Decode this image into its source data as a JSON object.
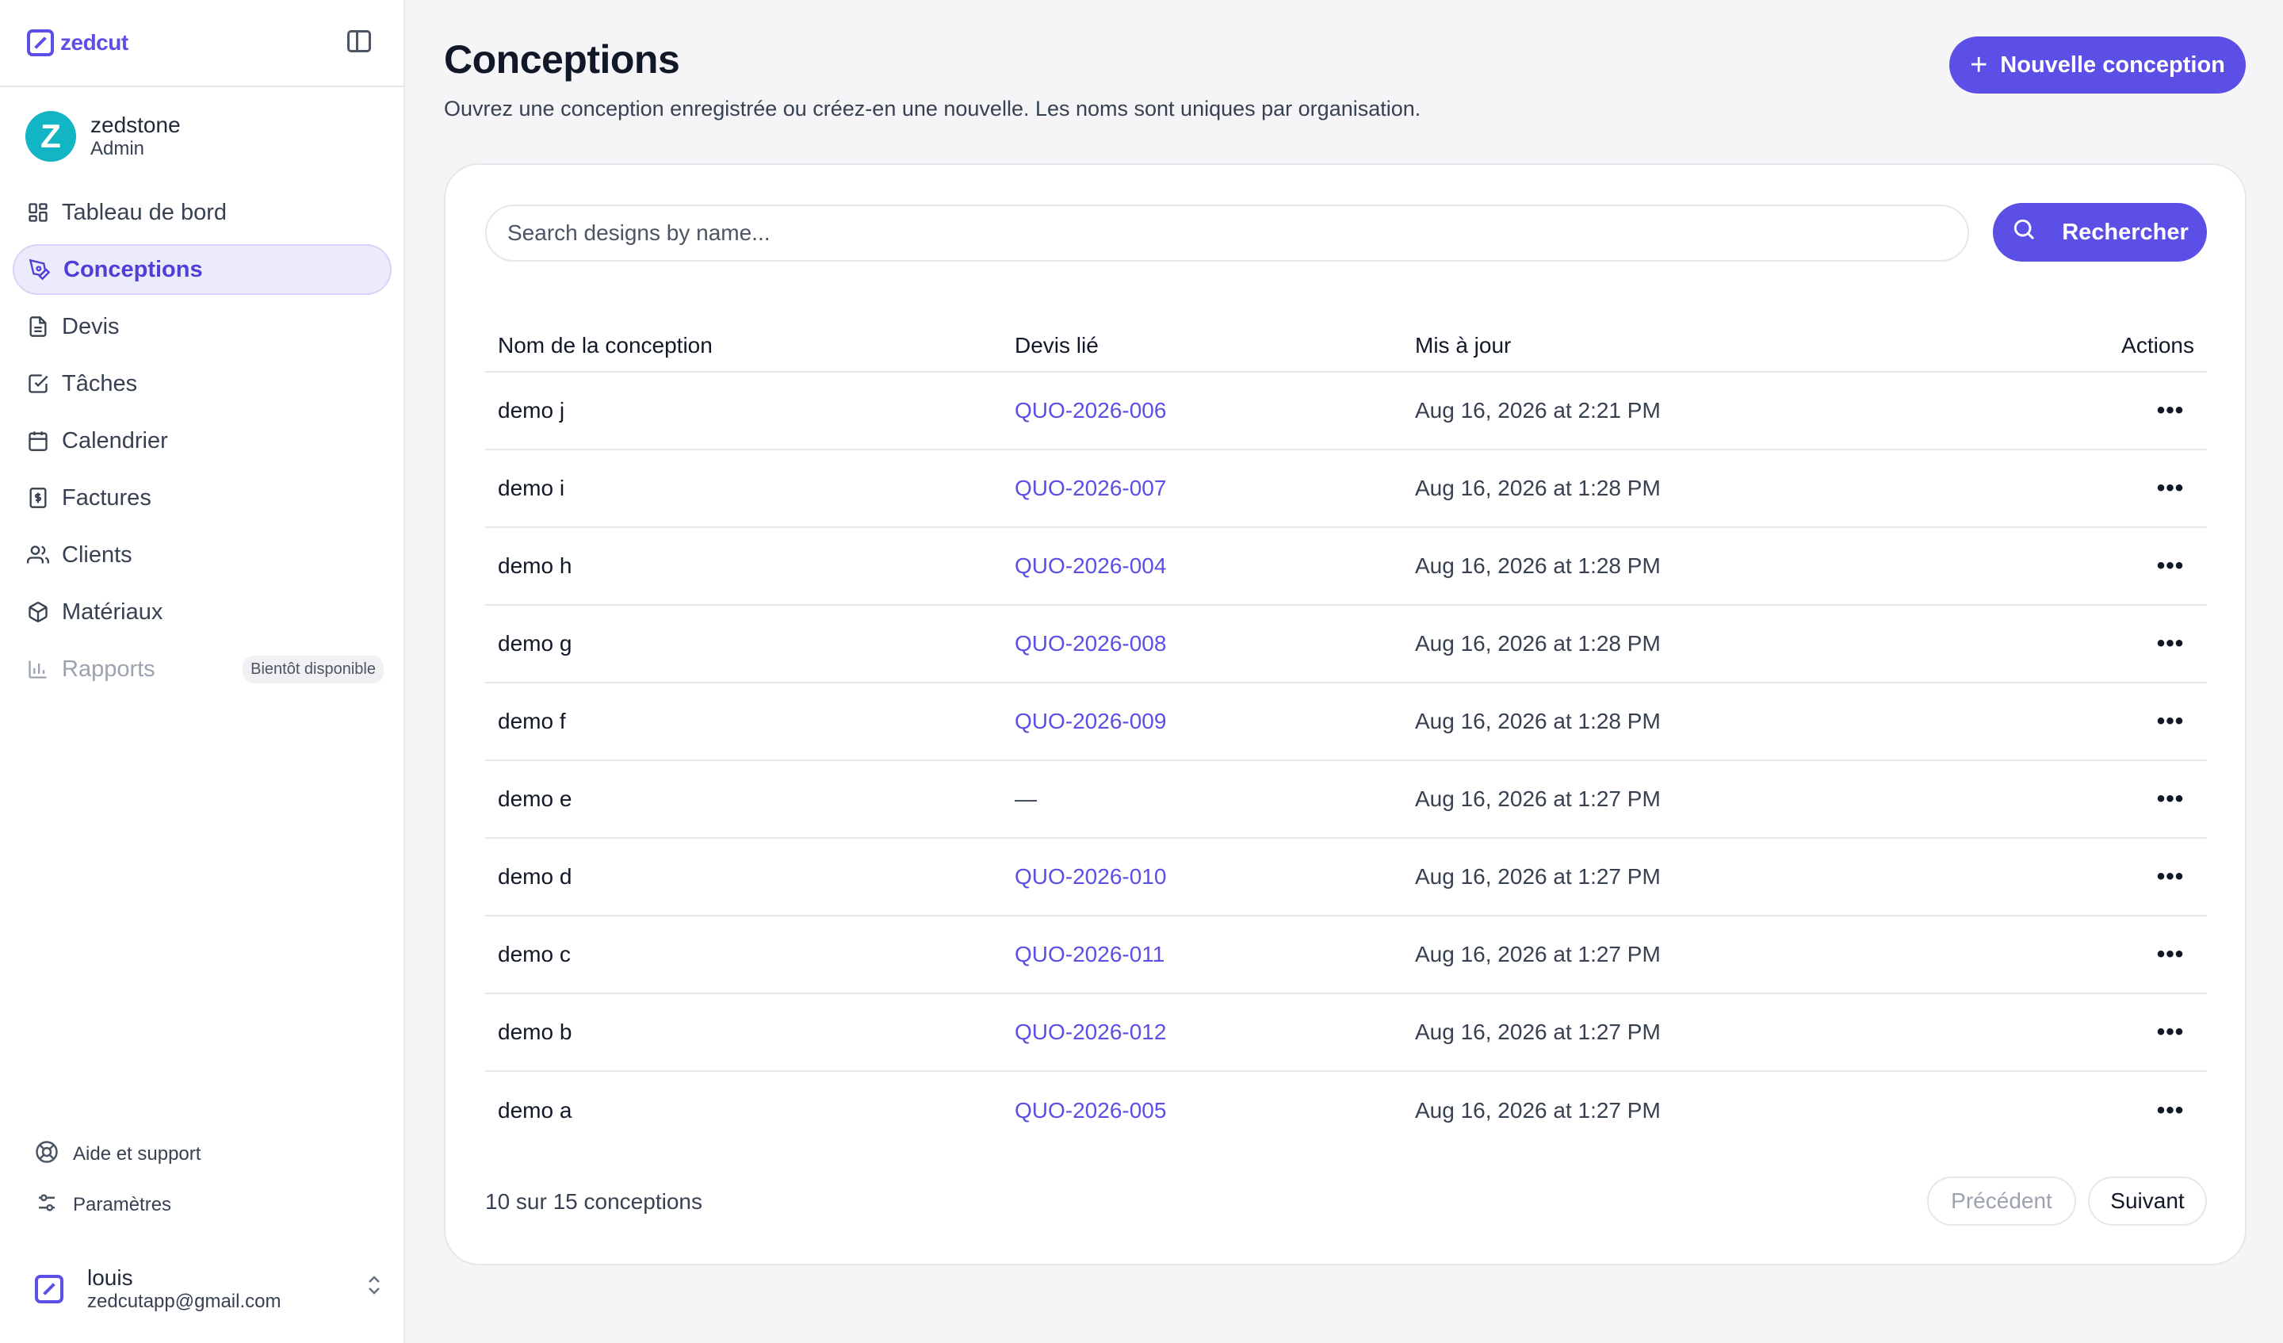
{
  "brand": {
    "name": "zedcut"
  },
  "org": {
    "initial": "Z",
    "name": "zedstone",
    "role": "Admin"
  },
  "nav": [
    {
      "label": "Tableau de bord",
      "icon": "dashboard-icon"
    },
    {
      "label": "Conceptions",
      "icon": "pen-tool-icon",
      "active": true
    },
    {
      "label": "Devis",
      "icon": "document-icon"
    },
    {
      "label": "Tâches",
      "icon": "checkbox-icon"
    },
    {
      "label": "Calendrier",
      "icon": "calendar-icon"
    },
    {
      "label": "Factures",
      "icon": "invoice-icon"
    },
    {
      "label": "Clients",
      "icon": "users-icon"
    },
    {
      "label": "Matériaux",
      "icon": "box-icon"
    },
    {
      "label": "Rapports",
      "icon": "bar-chart-icon",
      "disabled": true,
      "badge": "Bientôt disponible"
    }
  ],
  "bottom_links": [
    {
      "label": "Aide et support",
      "icon": "lifebuoy-icon"
    },
    {
      "label": "Paramètres",
      "icon": "sliders-icon"
    }
  ],
  "user": {
    "name": "louis",
    "email": "zedcutapp@gmail.com"
  },
  "page": {
    "title": "Conceptions",
    "subtitle": "Ouvrez une conception enregistrée ou créez-en une nouvelle. Les noms sont uniques par organisation.",
    "new_button": "Nouvelle conception"
  },
  "search": {
    "placeholder": "Search designs by name...",
    "button": "Rechercher"
  },
  "table": {
    "columns": [
      "Nom de la conception",
      "Devis lié",
      "Mis à jour",
      "Actions"
    ],
    "rows": [
      {
        "name": "demo j",
        "quote": "QUO-2026-006",
        "updated": "Aug 16, 2026 at 2:21 PM"
      },
      {
        "name": "demo i",
        "quote": "QUO-2026-007",
        "updated": "Aug 16, 2026 at 1:28 PM"
      },
      {
        "name": "demo h",
        "quote": "QUO-2026-004",
        "updated": "Aug 16, 2026 at 1:28 PM"
      },
      {
        "name": "demo g",
        "quote": "QUO-2026-008",
        "updated": "Aug 16, 2026 at 1:28 PM"
      },
      {
        "name": "demo f",
        "quote": "QUO-2026-009",
        "updated": "Aug 16, 2026 at 1:28 PM"
      },
      {
        "name": "demo e",
        "quote": "—",
        "updated": "Aug 16, 2026 at 1:27 PM"
      },
      {
        "name": "demo d",
        "quote": "QUO-2026-010",
        "updated": "Aug 16, 2026 at 1:27 PM"
      },
      {
        "name": "demo c",
        "quote": "QUO-2026-011",
        "updated": "Aug 16, 2026 at 1:27 PM"
      },
      {
        "name": "demo b",
        "quote": "QUO-2026-012",
        "updated": "Aug 16, 2026 at 1:27 PM"
      },
      {
        "name": "demo a",
        "quote": "QUO-2026-005",
        "updated": "Aug 16, 2026 at 1:27 PM"
      }
    ],
    "actions_glyph": "•••"
  },
  "pagination": {
    "summary": "10 sur 15 conceptions",
    "prev": "Précédent",
    "next": "Suivant"
  },
  "colors": {
    "accent": "#5b4fe6",
    "active_bg": "#ecebfc",
    "org_avatar": "#12b5c3"
  }
}
